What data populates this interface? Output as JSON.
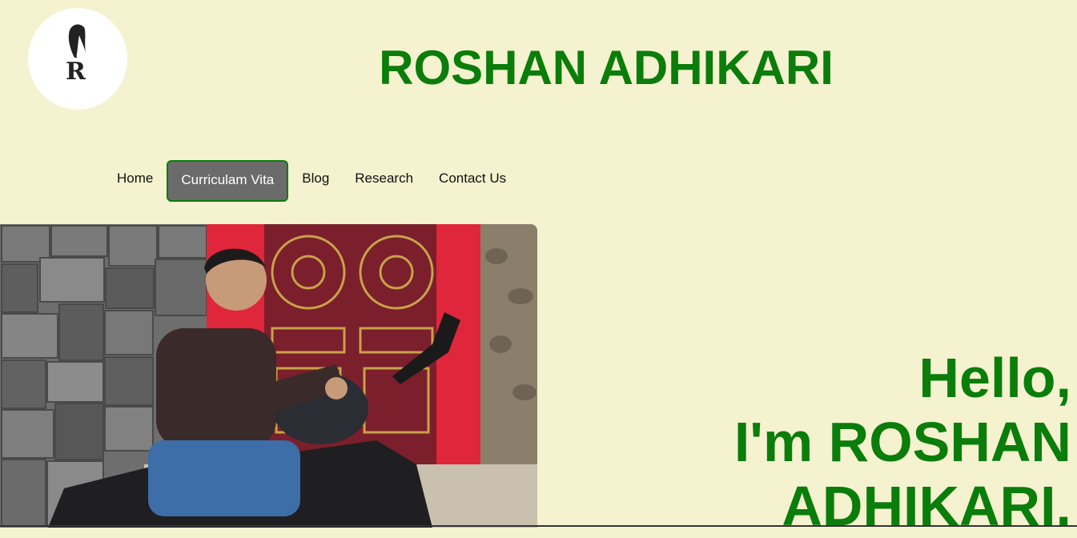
{
  "header": {
    "logo_letter": "R",
    "title": "ROSHAN ADHIKARI"
  },
  "nav": {
    "items": [
      {
        "label": "Home",
        "active": false
      },
      {
        "label": "Curriculam Vita",
        "active": true
      },
      {
        "label": "Blog",
        "active": false
      },
      {
        "label": "Research",
        "active": false
      },
      {
        "label": "Contact Us",
        "active": false
      }
    ]
  },
  "hero": {
    "greeting_line1": "Hello,",
    "greeting_line2": "I'm ROSHAN",
    "greeting_line3": "ADHIKARI."
  },
  "colors": {
    "background": "#f5f2cf",
    "brand_green": "#0a7d0a",
    "active_tab": "#6b6b6b"
  }
}
